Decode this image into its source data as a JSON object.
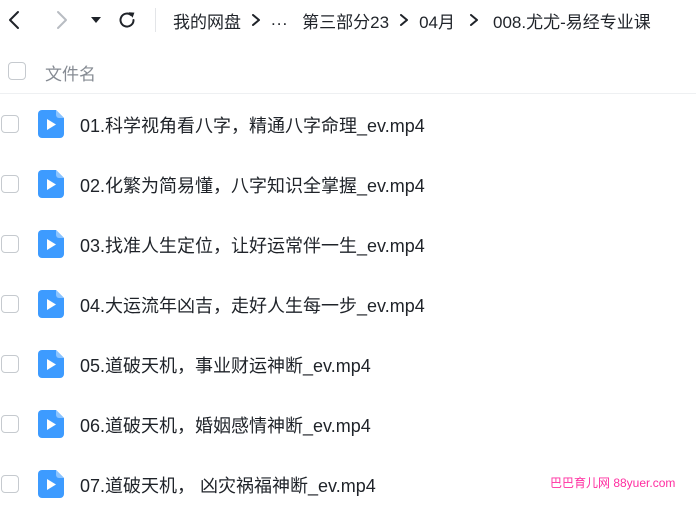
{
  "toolbar": {
    "back_icon": "chevron-left-icon",
    "forward_icon": "chevron-right-icon",
    "history_icon": "caret-down-icon",
    "refresh_icon": "refresh-icon"
  },
  "breadcrumb": {
    "root": "我的网盘",
    "ellipsis": "...",
    "items": [
      "第三部分23",
      "04月",
      "008.尤尤-易经专业课"
    ]
  },
  "list": {
    "header_label": "文件名",
    "files": [
      {
        "name": "01.科学视角看八字，精通八字命理_ev.mp4",
        "type_icon": "video-file-icon"
      },
      {
        "name": "02.化繁为简易懂，八字知识全掌握_ev.mp4",
        "type_icon": "video-file-icon"
      },
      {
        "name": "03.找准人生定位，让好运常伴一生_ev.mp4",
        "type_icon": "video-file-icon"
      },
      {
        "name": "04.大运流年凶吉，走好人生每一步_ev.mp4",
        "type_icon": "video-file-icon"
      },
      {
        "name": "05.道破天机，事业财运神断_ev.mp4",
        "type_icon": "video-file-icon"
      },
      {
        "name": "06.道破天机，婚姻感情神断_ev.mp4",
        "type_icon": "video-file-icon"
      },
      {
        "name": "07.道破天机， 凶灾祸福神断_ev.mp4",
        "type_icon": "video-file-icon"
      }
    ]
  },
  "watermark": "巴巴育儿网 88yuer.com",
  "colors": {
    "icon_blue": "#3d9bff",
    "text_primary": "#1f2329",
    "text_secondary": "#868b93",
    "watermark": "#ff2da0"
  }
}
